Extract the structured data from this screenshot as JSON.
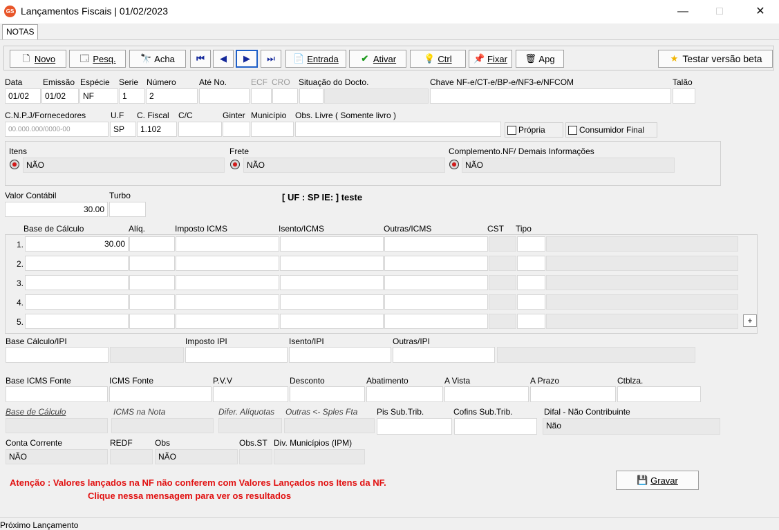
{
  "window": {
    "title": "Lançamentos Fiscais |  01/02/2023",
    "icon_text": "GS"
  },
  "tabs": [
    {
      "label": "NOTAS"
    }
  ],
  "toolbar": {
    "novo": "Novo",
    "pesq": "Pesq.",
    "acha": "Acha",
    "entrada": "Entrada",
    "ativar": "Ativar",
    "ctrl": "Ctrl",
    "fixar": "Fixar",
    "apg": "Apg",
    "beta": "Testar versão beta"
  },
  "header": {
    "labels": {
      "data": "Data",
      "emissao": "Emissão",
      "especie": "Espécie",
      "serie": "Serie",
      "numero": "Número",
      "ate_no": "Até No.",
      "ecf": "ECF",
      "cro": "CRO",
      "situacao": "Situação do Docto.",
      "chave": "Chave NF-e/CT-e/BP-e/NF3-e/NFCOM",
      "talao": "Talão",
      "cnpj": "C.N.P.J/Fornecedores",
      "uf": "U.F",
      "cfiscal": "C. Fiscal",
      "cc": "C/C",
      "ginter": "Ginter",
      "municipio": "Município",
      "obs_livre": "Obs. Livre ( Somente livro )",
      "propria": "Própria",
      "consumidor": "Consumidor Final"
    },
    "values": {
      "data": "01/02",
      "emissao": "01/02",
      "especie": "NF",
      "serie": "1",
      "numero": "2",
      "cnpj": "00.000.000/0000-00",
      "uf": "SP",
      "cfiscal": "1.102"
    }
  },
  "info_panel": {
    "itens_label": "Itens",
    "itens_value": "NÃO",
    "frete_label": "Frete",
    "frete_value": "NÃO",
    "compl_label": "Complemento.NF/ Demais Informações",
    "compl_value": "NÃO"
  },
  "valor": {
    "valor_contabil_label": "Valor Contábil",
    "valor_contabil": "30.00",
    "turbo_label": "Turbo",
    "uf_ie_text": "[ UF : SP IE:  ] teste"
  },
  "icms_grid": {
    "headers": {
      "base": "Base de Cálculo",
      "aliq": "Alíq.",
      "imposto": "Imposto ICMS",
      "isento": "Isento/ICMS",
      "outras": "Outras/ICMS",
      "cst": "CST",
      "tipo": "Tipo"
    },
    "rows": [
      {
        "n": "1.",
        "base": "30.00"
      },
      {
        "n": "2.",
        "base": ""
      },
      {
        "n": "3.",
        "base": ""
      },
      {
        "n": "4.",
        "base": ""
      },
      {
        "n": "5.",
        "base": ""
      }
    ],
    "plus": "+"
  },
  "ipi": {
    "base": "Base Cálculo/IPI",
    "imposto": "Imposto IPI",
    "isento": "Isento/IPI",
    "outras": "Outras/IPI"
  },
  "fonte": {
    "base_icms_fonte": "Base ICMS Fonte",
    "icms_fonte": "ICMS Fonte",
    "pvv": "P.V.V",
    "desconto": "Desconto",
    "abatimento": "Abatimento",
    "a_vista": "A Vista",
    "a_prazo": "A Prazo",
    "ctblza": "Ctblza."
  },
  "difal": {
    "base_calc": "Base de Cálculo",
    "icms_nota": "ICMS na Nota",
    "difer": "Difer. Alíquotas",
    "outras_sples": "Outras <- Sples Fta",
    "pis": "Pis Sub.Trib.",
    "cofins": "Cofins Sub.Trib.",
    "difal_label": "Difal - Não Contribuinte",
    "difal_value": "Não"
  },
  "footer": {
    "conta_corrente": "Conta Corrente",
    "conta_corrente_value": "NÃO",
    "redf": "REDF",
    "obs": "Obs",
    "obs_value": "NÃO",
    "obs_st": "Obs.ST",
    "div_mun": "Div. Municípios (IPM)",
    "alert1": "Atenção : Valores lançados na NF não conferem com Valores Lançados nos Itens da NF.",
    "alert2": "Clique nessa mensagem para ver os resultados",
    "gravar": "Gravar",
    "status": "Próximo  Lançamento"
  }
}
